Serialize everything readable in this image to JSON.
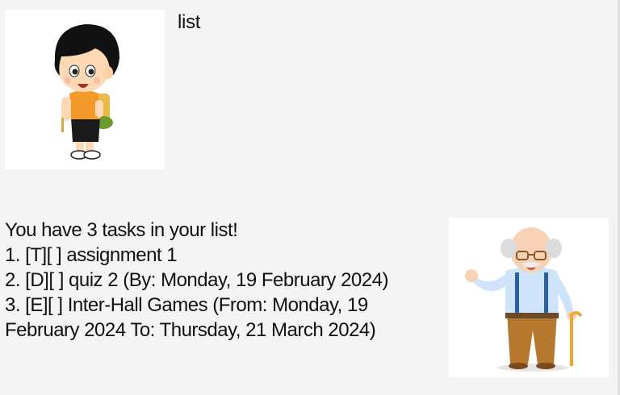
{
  "conversation": {
    "user_message": {
      "text": "list",
      "avatar": "boy-with-backpack-avatar"
    },
    "bot_message": {
      "lines": [
        "You have 3 tasks in your list!",
        "1. [T][ ] assignment 1",
        "2. [D][ ] quiz 2 (By: Monday, 19 February 2024)",
        "3. [E][ ] Inter-Hall Games (From: Monday, 19",
        "February 2024 To: Thursday, 21 March 2024)"
      ],
      "avatar": "old-man-with-cane-avatar"
    }
  }
}
